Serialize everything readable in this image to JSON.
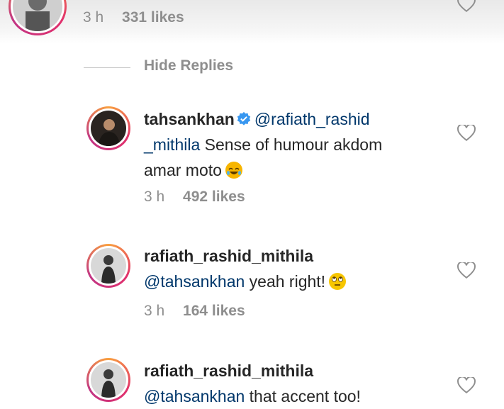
{
  "top_comment": {
    "time": "3 h",
    "likes": "331 likes"
  },
  "hide_replies_label": "Hide Replies",
  "replies": [
    {
      "username": "tahsankhan",
      "verified": true,
      "mention_part1": "@rafiath_rashid",
      "mention_part2": "_mithila",
      "text_line1": " Sense of humour akdom",
      "text_line2": "amar moto",
      "emoji": "laughing-face-emoji",
      "time": "3 h",
      "likes": "492 likes"
    },
    {
      "username": "rafiath_rashid_mithila",
      "mention": "@tahsankhan",
      "text": " yeah right!",
      "emoji": "eye-roll-emoji",
      "time": "3 h",
      "likes": "164 likes"
    },
    {
      "username": "rafiath_rashid_mithila",
      "mention": "@tahsankhan",
      "text": " that accent too!"
    }
  ],
  "colors": {
    "mention": "#00376b",
    "meta": "#8e8e8e",
    "verified": "#3897f0"
  }
}
